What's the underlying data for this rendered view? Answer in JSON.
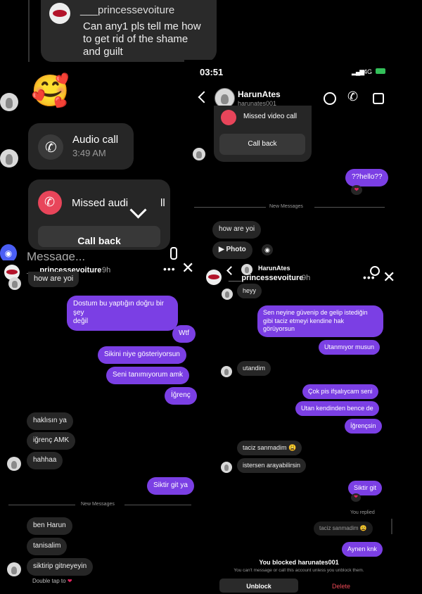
{
  "top": {
    "quote_username": "___princessevoiture",
    "quote_text_1": "Can any1 pls tell me how",
    "quote_text_2": "to get rid of the shame",
    "quote_text_3": "and guilt",
    "emoji": "🥰",
    "audio_call_title": "Audio call",
    "audio_call_time": "3:49 AM",
    "missed_audio_title": "Missed audi",
    "missed_audio_tail": "ll",
    "call_back": "Call back",
    "composer_placeholder": "Message..."
  },
  "phone": {
    "time": "03:51",
    "network": "4G",
    "contact_name": "HarunAtes",
    "contact_handle": "harunates001",
    "missed_video": "Missed video call",
    "call_back": "Call back",
    "hello": "??hello??",
    "new_messages": "New Messages",
    "how_are_you": "how are yoi",
    "photo": "Photo"
  },
  "left": {
    "username": "___princessevoiture",
    "time": "9h",
    "top_msg": "how are yoi",
    "out_msgs": [
      "Dostum bu yaptığın doğru bir şey",
      "değil",
      "Wtf",
      "Sikini niye gösteriyorsun",
      "Seni tanımıyorum amk",
      "İğrenç"
    ],
    "in_msgs": [
      "haklısın ya",
      "iğrenç AMK",
      "hahhaa"
    ],
    "reply": "Siktir git ya",
    "new_messages": "New Messages",
    "in_msgs2": [
      "ben Harun",
      "tanisalim",
      "siktirip gitneyeyin"
    ],
    "double_tap": "Double tap to"
  },
  "right": {
    "header_name": "HarunAtes",
    "username": "___princessevoiture",
    "time": "9h",
    "heyy": "heyy",
    "out1": [
      "Sen neyine güvenip de gelip istediğin",
      "gibi taciz etmeyi kendine hak",
      "görüyorsun"
    ],
    "out2": "Utanmıyor musun",
    "utandim": "utandim",
    "out3": [
      "Çok pis ifşalıycam seni",
      "Utan kendinden bence de",
      "İğrençsin"
    ],
    "in2": [
      "taciz sanmadim 😩",
      "istersen arayabilirsin"
    ],
    "siktir": "Siktir git",
    "you_replied": "You replied",
    "quoted": "taciz sanmadim 😩",
    "aynen": "Aynen knk",
    "blocked_title": "You blocked harunates001",
    "blocked_sub": "You can't message or call this account unless you unblock them.",
    "unblock": "Unblock",
    "delete": "Delete"
  },
  "colors": {
    "accent": "#7b3fe4",
    "incoming": "#262626",
    "missed": "#e8455a",
    "delete": "#ed4956"
  }
}
